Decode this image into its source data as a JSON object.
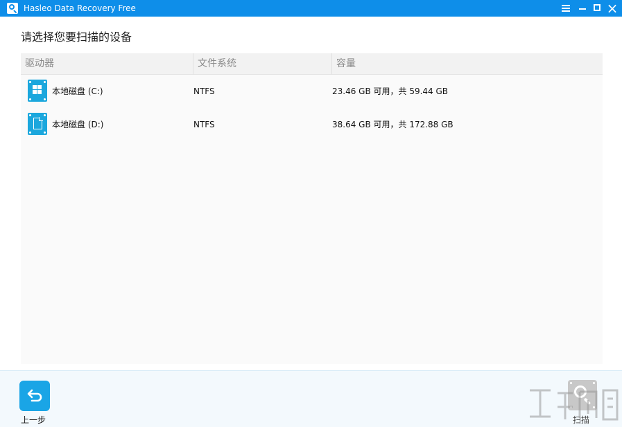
{
  "window": {
    "title": "Hasleo Data Recovery Free",
    "controls": [
      "menu-icon",
      "minimize-icon",
      "maximize-icon",
      "close-icon"
    ]
  },
  "page": {
    "title": "请选择您要扫描的设备"
  },
  "table": {
    "columns": [
      "驱动器",
      "文件系统",
      "容量"
    ],
    "rows": [
      {
        "icon": "windows-drive-icon",
        "name": "本地磁盘 (C:)",
        "file_system": "NTFS",
        "capacity": "23.46 GB 可用，共 59.44 GB"
      },
      {
        "icon": "document-drive-icon",
        "name": "本地磁盘 (D:)",
        "file_system": "NTFS",
        "capacity": "38.64 GB 可用，共 172.88 GB"
      }
    ]
  },
  "footer": {
    "back_label": "上一步",
    "scan_label": "扫描"
  },
  "colors": {
    "titlebar": "#0e8ee9",
    "accent": "#1aa5e6",
    "drive_icon": "#1ba7dd",
    "disabled": "#c8c8c8"
  }
}
